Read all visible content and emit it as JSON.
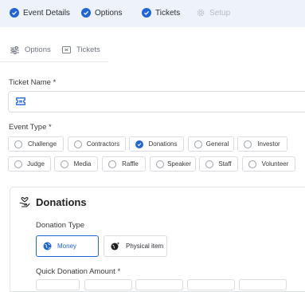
{
  "stepper": {
    "steps": [
      {
        "label": "Event Details",
        "state": "done"
      },
      {
        "label": "Options",
        "state": "done"
      },
      {
        "label": "Tickets",
        "state": "done"
      },
      {
        "label": "Setup",
        "state": "disabled"
      }
    ]
  },
  "subtabs": [
    {
      "label": "Options",
      "icon": "sliders-icon"
    },
    {
      "label": "Tickets",
      "icon": "ticket-icon"
    }
  ],
  "ticket_name": {
    "label": "Ticket Name *",
    "value": "",
    "icon": "ticket-icon"
  },
  "event_type": {
    "label": "Event Type *",
    "selected": "Donations",
    "options": [
      "Challenge",
      "Contractors",
      "Donations",
      "General",
      "Investor",
      "Judge",
      "Media",
      "Raffle",
      "Speaker",
      "Staff",
      "Volunteer"
    ]
  },
  "donations": {
    "title": "Donations",
    "icon": "hand-heart-icon",
    "donation_type_label": "Donation Type",
    "types": [
      {
        "label": "Money",
        "icon": "globe-icon",
        "selected": true
      },
      {
        "label": "Physical item",
        "icon": "sparkle-globe-icon",
        "selected": false
      }
    ],
    "quick_amount_label": "Quick Donation Amount *"
  },
  "colors": {
    "accent": "#2166d4",
    "stepper_bg": "#eef3fb",
    "disabled": "#b8bcc4"
  }
}
